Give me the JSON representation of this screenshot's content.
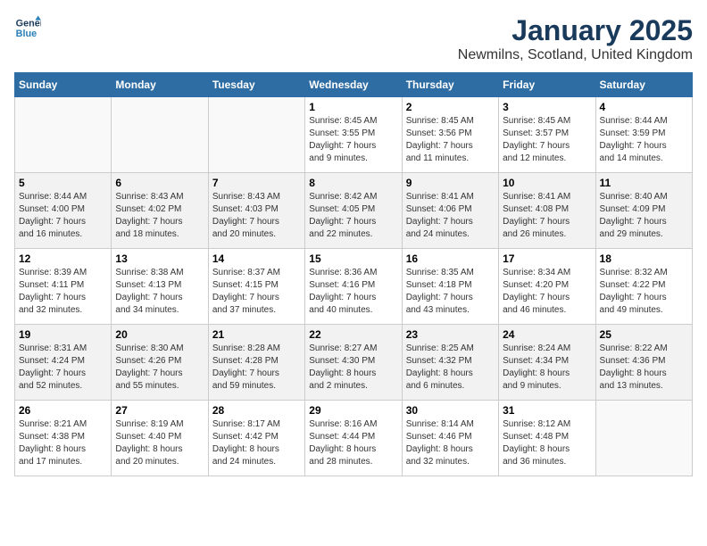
{
  "logo": {
    "line1": "General",
    "line2": "Blue"
  },
  "title": "January 2025",
  "subtitle": "Newmilns, Scotland, United Kingdom",
  "days_header": [
    "Sunday",
    "Monday",
    "Tuesday",
    "Wednesday",
    "Thursday",
    "Friday",
    "Saturday"
  ],
  "weeks": [
    [
      {
        "day": "",
        "info": ""
      },
      {
        "day": "",
        "info": ""
      },
      {
        "day": "",
        "info": ""
      },
      {
        "day": "1",
        "info": "Sunrise: 8:45 AM\nSunset: 3:55 PM\nDaylight: 7 hours\nand 9 minutes."
      },
      {
        "day": "2",
        "info": "Sunrise: 8:45 AM\nSunset: 3:56 PM\nDaylight: 7 hours\nand 11 minutes."
      },
      {
        "day": "3",
        "info": "Sunrise: 8:45 AM\nSunset: 3:57 PM\nDaylight: 7 hours\nand 12 minutes."
      },
      {
        "day": "4",
        "info": "Sunrise: 8:44 AM\nSunset: 3:59 PM\nDaylight: 7 hours\nand 14 minutes."
      }
    ],
    [
      {
        "day": "5",
        "info": "Sunrise: 8:44 AM\nSunset: 4:00 PM\nDaylight: 7 hours\nand 16 minutes."
      },
      {
        "day": "6",
        "info": "Sunrise: 8:43 AM\nSunset: 4:02 PM\nDaylight: 7 hours\nand 18 minutes."
      },
      {
        "day": "7",
        "info": "Sunrise: 8:43 AM\nSunset: 4:03 PM\nDaylight: 7 hours\nand 20 minutes."
      },
      {
        "day": "8",
        "info": "Sunrise: 8:42 AM\nSunset: 4:05 PM\nDaylight: 7 hours\nand 22 minutes."
      },
      {
        "day": "9",
        "info": "Sunrise: 8:41 AM\nSunset: 4:06 PM\nDaylight: 7 hours\nand 24 minutes."
      },
      {
        "day": "10",
        "info": "Sunrise: 8:41 AM\nSunset: 4:08 PM\nDaylight: 7 hours\nand 26 minutes."
      },
      {
        "day": "11",
        "info": "Sunrise: 8:40 AM\nSunset: 4:09 PM\nDaylight: 7 hours\nand 29 minutes."
      }
    ],
    [
      {
        "day": "12",
        "info": "Sunrise: 8:39 AM\nSunset: 4:11 PM\nDaylight: 7 hours\nand 32 minutes."
      },
      {
        "day": "13",
        "info": "Sunrise: 8:38 AM\nSunset: 4:13 PM\nDaylight: 7 hours\nand 34 minutes."
      },
      {
        "day": "14",
        "info": "Sunrise: 8:37 AM\nSunset: 4:15 PM\nDaylight: 7 hours\nand 37 minutes."
      },
      {
        "day": "15",
        "info": "Sunrise: 8:36 AM\nSunset: 4:16 PM\nDaylight: 7 hours\nand 40 minutes."
      },
      {
        "day": "16",
        "info": "Sunrise: 8:35 AM\nSunset: 4:18 PM\nDaylight: 7 hours\nand 43 minutes."
      },
      {
        "day": "17",
        "info": "Sunrise: 8:34 AM\nSunset: 4:20 PM\nDaylight: 7 hours\nand 46 minutes."
      },
      {
        "day": "18",
        "info": "Sunrise: 8:32 AM\nSunset: 4:22 PM\nDaylight: 7 hours\nand 49 minutes."
      }
    ],
    [
      {
        "day": "19",
        "info": "Sunrise: 8:31 AM\nSunset: 4:24 PM\nDaylight: 7 hours\nand 52 minutes."
      },
      {
        "day": "20",
        "info": "Sunrise: 8:30 AM\nSunset: 4:26 PM\nDaylight: 7 hours\nand 55 minutes."
      },
      {
        "day": "21",
        "info": "Sunrise: 8:28 AM\nSunset: 4:28 PM\nDaylight: 7 hours\nand 59 minutes."
      },
      {
        "day": "22",
        "info": "Sunrise: 8:27 AM\nSunset: 4:30 PM\nDaylight: 8 hours\nand 2 minutes."
      },
      {
        "day": "23",
        "info": "Sunrise: 8:25 AM\nSunset: 4:32 PM\nDaylight: 8 hours\nand 6 minutes."
      },
      {
        "day": "24",
        "info": "Sunrise: 8:24 AM\nSunset: 4:34 PM\nDaylight: 8 hours\nand 9 minutes."
      },
      {
        "day": "25",
        "info": "Sunrise: 8:22 AM\nSunset: 4:36 PM\nDaylight: 8 hours\nand 13 minutes."
      }
    ],
    [
      {
        "day": "26",
        "info": "Sunrise: 8:21 AM\nSunset: 4:38 PM\nDaylight: 8 hours\nand 17 minutes."
      },
      {
        "day": "27",
        "info": "Sunrise: 8:19 AM\nSunset: 4:40 PM\nDaylight: 8 hours\nand 20 minutes."
      },
      {
        "day": "28",
        "info": "Sunrise: 8:17 AM\nSunset: 4:42 PM\nDaylight: 8 hours\nand 24 minutes."
      },
      {
        "day": "29",
        "info": "Sunrise: 8:16 AM\nSunset: 4:44 PM\nDaylight: 8 hours\nand 28 minutes."
      },
      {
        "day": "30",
        "info": "Sunrise: 8:14 AM\nSunset: 4:46 PM\nDaylight: 8 hours\nand 32 minutes."
      },
      {
        "day": "31",
        "info": "Sunrise: 8:12 AM\nSunset: 4:48 PM\nDaylight: 8 hours\nand 36 minutes."
      },
      {
        "day": "",
        "info": ""
      }
    ]
  ]
}
